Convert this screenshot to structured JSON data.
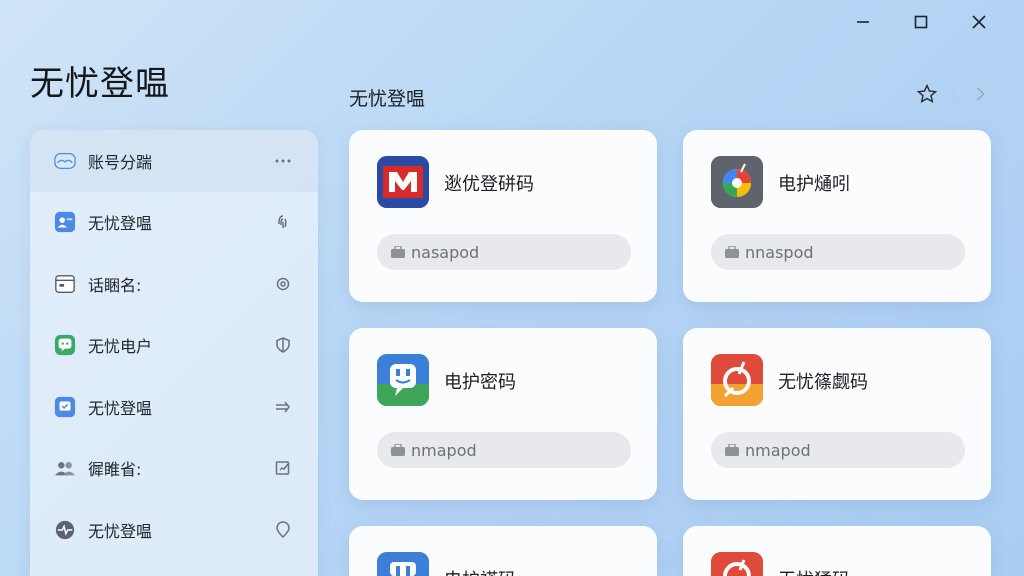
{
  "app": {
    "title": "无忧登嗢"
  },
  "window_controls": [
    "minimize-icon",
    "maximize-icon",
    "close-icon"
  ],
  "main": {
    "section_title": "无忧登嗢",
    "top_actions": [
      "star-icon",
      "chevron-right-icon"
    ]
  },
  "sidebar": {
    "items": [
      {
        "label": "账号分踹",
        "icon": "cloud-icon",
        "action": "more-icon",
        "active": true
      },
      {
        "label": "无忧登嗢",
        "icon": "id-card-icon",
        "action": "fingerprint-icon"
      },
      {
        "label": "话睏名:",
        "icon": "calendar-icon",
        "action": "gear-icon"
      },
      {
        "label": "无忧电户",
        "icon": "chat-icon",
        "action": "shield-icon"
      },
      {
        "label": "无忧登嗢",
        "icon": "tag-icon",
        "action": "arrow-right-icon"
      },
      {
        "label": "徲睢省:",
        "icon": "users-icon",
        "action": "edit-icon"
      },
      {
        "label": "无忧登嗢",
        "icon": "pulse-icon",
        "action": "location-icon"
      }
    ]
  },
  "cards": [
    {
      "name": "逖优登硑码",
      "field": "nasapod",
      "logo": "m-logo"
    },
    {
      "name": "电护熥吲",
      "field": "nnaspod",
      "logo": "pinwheel-logo"
    },
    {
      "name": "电护密码",
      "field": "nmapod",
      "logo": "face-logo"
    },
    {
      "name": "无忧篠觑码",
      "field": "nmapod",
      "logo": "orange-logo"
    },
    {
      "name": "电护褡码",
      "field": "",
      "logo": "face-logo"
    },
    {
      "name": "无忧猱码",
      "field": "",
      "logo": "orange-logo"
    }
  ],
  "colors": {
    "accent": "#3c7de0",
    "background": "#b7d6f5",
    "card": "#fbfcfd"
  }
}
